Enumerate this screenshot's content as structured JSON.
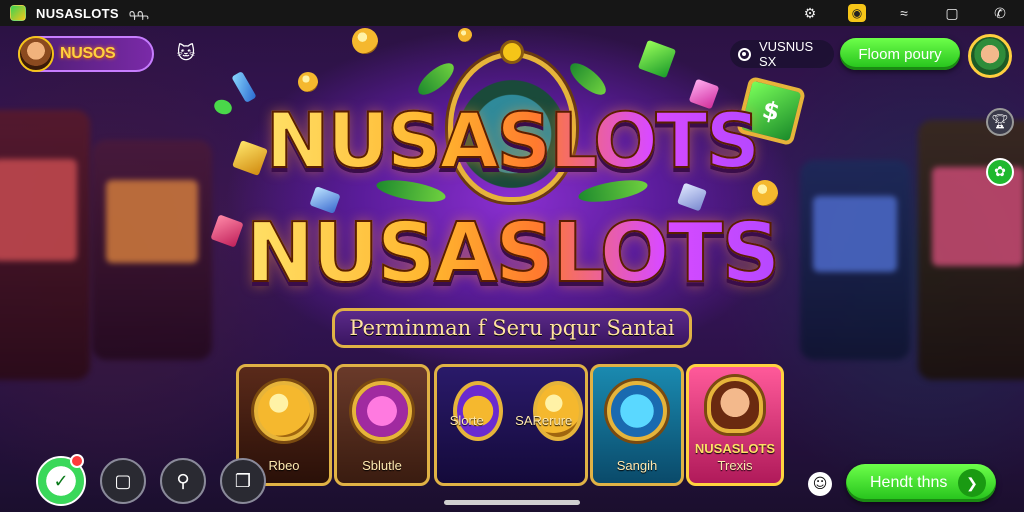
{
  "statusbar": {
    "title": "NUSASLOTS",
    "extra": "ᠲᠲ",
    "icons": [
      "settings-icon",
      "badge-icon",
      "signal-icon",
      "window-icon",
      "call-icon"
    ]
  },
  "profile": {
    "name": "NUSOS"
  },
  "status_chip": {
    "label": "VUSNUS SX"
  },
  "top_button": {
    "label": "Floom poury"
  },
  "hero": {
    "title_line1": "NUSASLOTS",
    "title_line2": "NUSASLOTS",
    "subtitle": "Perminman f Seru pqur Santai"
  },
  "games": [
    {
      "label": "Rbeo"
    },
    {
      "label": "Sblutle"
    },
    {
      "label": "Slorte"
    },
    {
      "label": "SARerure"
    },
    {
      "label": "Sangih"
    },
    {
      "label": "NUSASLOTS",
      "sub": "Trexis"
    }
  ],
  "bottom_button": {
    "label": "Hendt thns"
  },
  "colors": {
    "accent_green": "#22c01a",
    "gold": "#e0b245",
    "purple": "#5a1c9a"
  }
}
